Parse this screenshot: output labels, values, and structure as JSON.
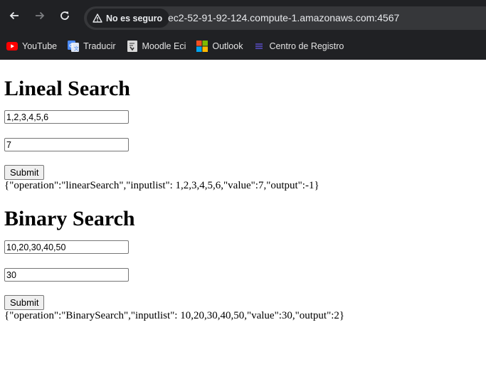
{
  "browser": {
    "security_label": "No es seguro",
    "url": "ec2-52-91-92-124.compute-1.amazonaws.com:4567",
    "bookmarks": [
      {
        "label": "YouTube",
        "icon": "youtube-icon"
      },
      {
        "label": "Traducir",
        "icon": "translate-icon"
      },
      {
        "label": "Moodle Eci",
        "icon": "moodle-icon"
      },
      {
        "label": "Outlook",
        "icon": "microsoft-icon"
      },
      {
        "label": "Centro de Registro",
        "icon": "registro-icon"
      }
    ]
  },
  "linear": {
    "title": "Lineal Search",
    "list_value": "1,2,3,4,5,6",
    "search_value": "7",
    "submit_label": "Submit",
    "result": "{\"operation\":\"linearSearch\",\"inputlist\": 1,2,3,4,5,6,\"value\":7,\"output\":-1}"
  },
  "binary": {
    "title": "Binary Search",
    "list_value": "10,20,30,40,50",
    "search_value": "30",
    "submit_label": "Submit",
    "result": "{\"operation\":\"BinarySearch\",\"inputlist\": 10,20,30,40,50,\"value\":30,\"output\":2}"
  }
}
